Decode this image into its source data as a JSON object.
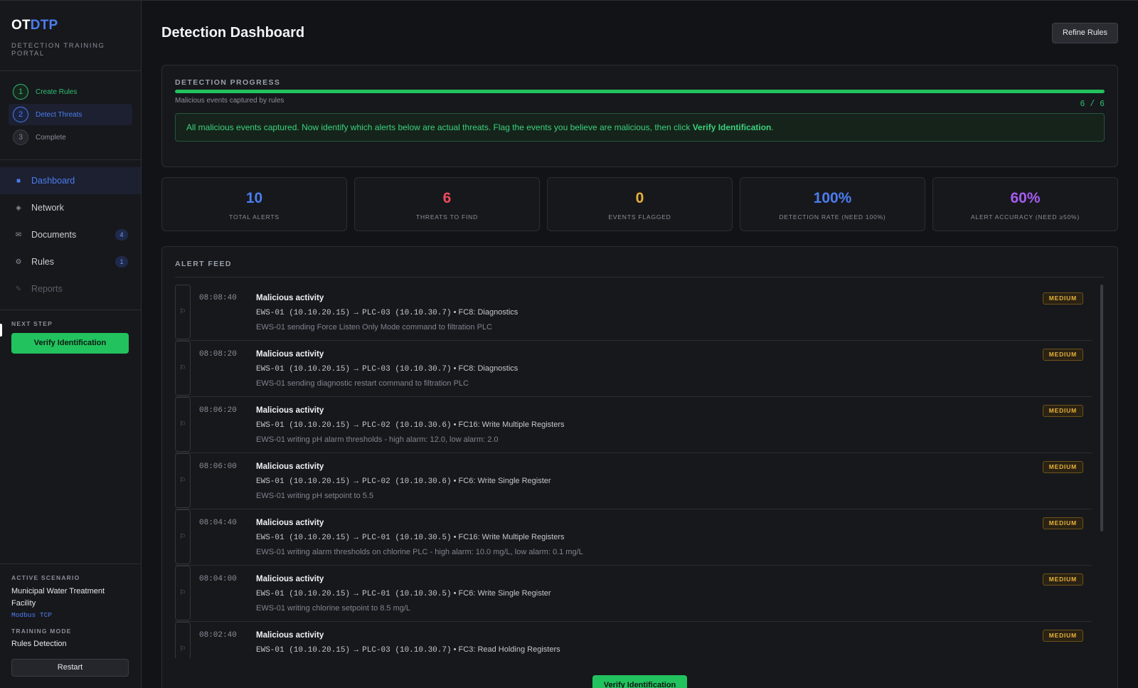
{
  "brand": {
    "prefix": "OT",
    "suffix": "DTP",
    "subtitle": "DETECTION TRAINING PORTAL"
  },
  "steps": [
    {
      "num": "1",
      "label": "Create Rules",
      "state": "done"
    },
    {
      "num": "2",
      "label": "Detect Threats",
      "state": "active"
    },
    {
      "num": "3",
      "label": "Complete",
      "state": "pending"
    }
  ],
  "nav": [
    {
      "label": "Dashboard",
      "icon": "square-icon",
      "glyph": "■",
      "count": "",
      "state": "active"
    },
    {
      "label": "Network",
      "icon": "diamond-icon",
      "glyph": "◈",
      "count": "",
      "state": ""
    },
    {
      "label": "Documents",
      "icon": "envelope-icon",
      "glyph": "✉",
      "count": "4",
      "state": ""
    },
    {
      "label": "Rules",
      "icon": "gear-icon",
      "glyph": "⚙",
      "count": "1",
      "state": ""
    },
    {
      "label": "Reports",
      "icon": "pencil-icon",
      "glyph": "✎",
      "count": "",
      "state": "disabled"
    }
  ],
  "next_step": {
    "label": "NEXT STEP",
    "button": "Verify Identification"
  },
  "scenario": {
    "label": "ACTIVE SCENARIO",
    "name_line1": "Municipal Water Treatment",
    "name_line2": "Facility",
    "protocol": "Modbus TCP",
    "mode_label": "TRAINING MODE",
    "mode": "Rules Detection",
    "restart": "Restart"
  },
  "header": {
    "title": "Detection Dashboard",
    "refine": "Refine Rules"
  },
  "progress": {
    "title": "DETECTION PROGRESS",
    "caption": "Malicious events captured by rules",
    "captured": 6,
    "total": 6,
    "count_text": "6 / 6",
    "banner_text": "All malicious events captured. Now identify which alerts below are actual threats. Flag the events you believe are malicious, then click ",
    "banner_bold": "Verify Identification",
    "banner_end": "."
  },
  "stats": [
    {
      "value": "10",
      "label": "TOTAL ALERTS",
      "color": "#4c7df0"
    },
    {
      "value": "6",
      "label": "THREATS TO FIND",
      "color": "#ef4a5f"
    },
    {
      "value": "0",
      "label": "EVENTS FLAGGED",
      "color": "#e8b33a"
    },
    {
      "value": "100%",
      "label": "DETECTION RATE (NEED 100%)",
      "color": "#4c7df0"
    },
    {
      "value": "60%",
      "label": "ALERT ACCURACY (NEED ≥50%)",
      "color": "#a55cf0"
    }
  ],
  "feed": {
    "title": "ALERT FEED",
    "verify_button": "Verify Identification",
    "alerts": [
      {
        "time": "08:08:40",
        "title": "Malicious activity",
        "src": "EWS-01 (10.10.20.15)",
        "dst": "PLC-03 (10.10.30.7)",
        "fc": "• FC8: Diagnostics",
        "desc": "EWS-01 sending Force Listen Only Mode command to filtration PLC",
        "severity": "MEDIUM"
      },
      {
        "time": "08:08:20",
        "title": "Malicious activity",
        "src": "EWS-01 (10.10.20.15)",
        "dst": "PLC-03 (10.10.30.7)",
        "fc": "• FC8: Diagnostics",
        "desc": "EWS-01 sending diagnostic restart command to filtration PLC",
        "severity": "MEDIUM"
      },
      {
        "time": "08:06:20",
        "title": "Malicious activity",
        "src": "EWS-01 (10.10.20.15)",
        "dst": "PLC-02 (10.10.30.6)",
        "fc": "• FC16: Write Multiple Registers",
        "desc": "EWS-01 writing pH alarm thresholds - high alarm: 12.0, low alarm: 2.0",
        "severity": "MEDIUM"
      },
      {
        "time": "08:06:00",
        "title": "Malicious activity",
        "src": "EWS-01 (10.10.20.15)",
        "dst": "PLC-02 (10.10.30.6)",
        "fc": "• FC6: Write Single Register",
        "desc": "EWS-01 writing pH setpoint to 5.5",
        "severity": "MEDIUM"
      },
      {
        "time": "08:04:40",
        "title": "Malicious activity",
        "src": "EWS-01 (10.10.20.15)",
        "dst": "PLC-01 (10.10.30.5)",
        "fc": "• FC16: Write Multiple Registers",
        "desc": "EWS-01 writing alarm thresholds on chlorine PLC - high alarm: 10.0 mg/L, low alarm: 0.1 mg/L",
        "severity": "MEDIUM"
      },
      {
        "time": "08:04:00",
        "title": "Malicious activity",
        "src": "EWS-01 (10.10.20.15)",
        "dst": "PLC-01 (10.10.30.5)",
        "fc": "• FC6: Write Single Register",
        "desc": "EWS-01 writing chlorine setpoint to 8.5 mg/L",
        "severity": "MEDIUM"
      },
      {
        "time": "08:02:40",
        "title": "Malicious activity",
        "src": "EWS-01 (10.10.20.15)",
        "dst": "PLC-03 (10.10.30.7)",
        "fc": "• FC3: Read Holding Registers",
        "desc": "",
        "severity": "MEDIUM"
      }
    ]
  }
}
